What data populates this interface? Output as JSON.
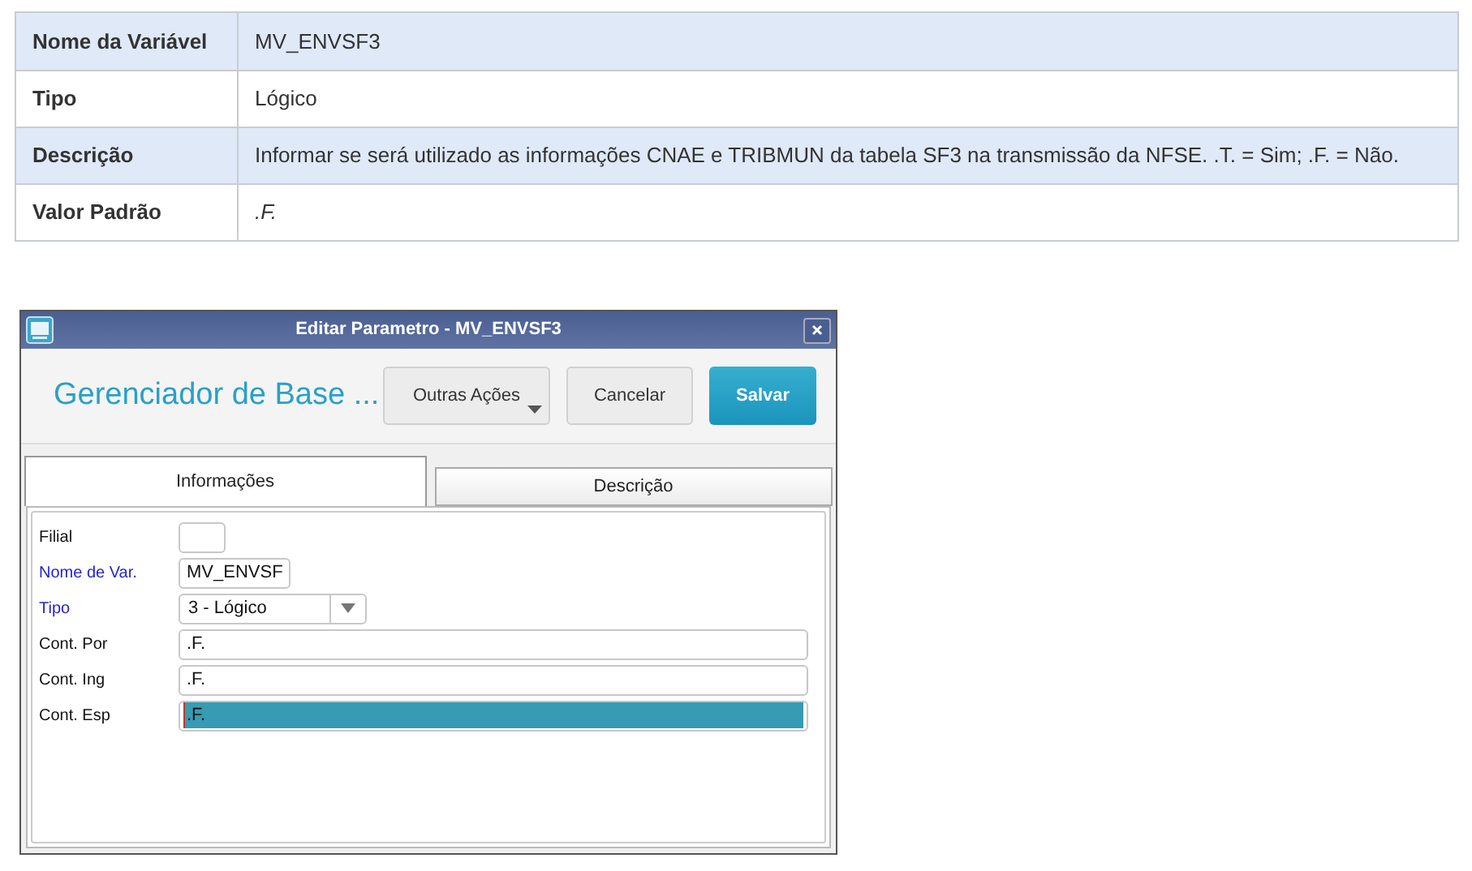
{
  "table": {
    "rows": [
      {
        "label": "Nome da Variável",
        "value": "MV_ENVSF3",
        "italic": false
      },
      {
        "label": "Tipo",
        "value": "Lógico",
        "italic": false
      },
      {
        "label": "Descrição",
        "value": "Informar se será utilizado as informações CNAE e TRIBMUN da tabela SF3 na transmissão da NFSE. .T. = Sim; .F. = Não.",
        "italic": false
      },
      {
        "label": "Valor Padrão",
        "value": ".F.",
        "italic": true
      }
    ]
  },
  "dialog": {
    "title": "Editar Parametro - MV_ENVSF3",
    "heading": "Gerenciador de Base ...",
    "buttons": [
      {
        "label": "Outras Ações",
        "kind": "menu"
      },
      {
        "label": "Cancelar",
        "kind": "plain"
      },
      {
        "label": "Salvar",
        "kind": "primary"
      }
    ],
    "tabs": [
      {
        "label": "Informações",
        "selected": true
      },
      {
        "label": "Descrição",
        "selected": false
      }
    ],
    "fields": [
      {
        "label": "Filial",
        "required": false,
        "kind": "small"
      },
      {
        "label": "Nome de Var.",
        "required": true,
        "kind": "short",
        "value": "MV_ENVSF",
        "selected": false
      },
      {
        "label": "Tipo",
        "required": true,
        "kind": "select",
        "value": "3 - Lógico"
      },
      {
        "label": "Cont. Por",
        "required": false,
        "kind": "wide",
        "value": ".F.",
        "selected": false
      },
      {
        "label": "Cont. Ing",
        "required": false,
        "kind": "wide",
        "value": ".F.",
        "selected": false
      },
      {
        "label": "Cont. Esp",
        "required": false,
        "kind": "wide",
        "value": ".F.",
        "selected": true
      }
    ]
  }
}
